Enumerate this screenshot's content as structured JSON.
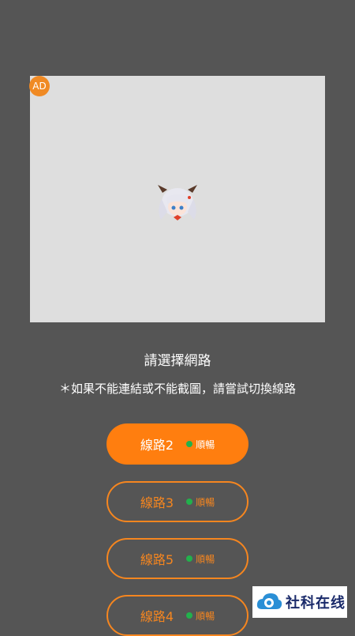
{
  "ad": {
    "badge": "AD"
  },
  "header": {
    "title": "請選擇網路",
    "notice": "＊如果不能連結或不能截圖，請嘗試切換線路"
  },
  "routes": [
    {
      "label": "線路2",
      "status": "順暢",
      "active": true
    },
    {
      "label": "線路3",
      "status": "順暢",
      "active": false
    },
    {
      "label": "線路5",
      "status": "順暢",
      "active": false
    },
    {
      "label": "線路4",
      "status": "順暢",
      "active": false
    }
  ],
  "colors": {
    "accent": "#ff7e0f",
    "status_ok": "#22b14c",
    "background": "#555555"
  },
  "watermark": {
    "text": "社科在线"
  }
}
